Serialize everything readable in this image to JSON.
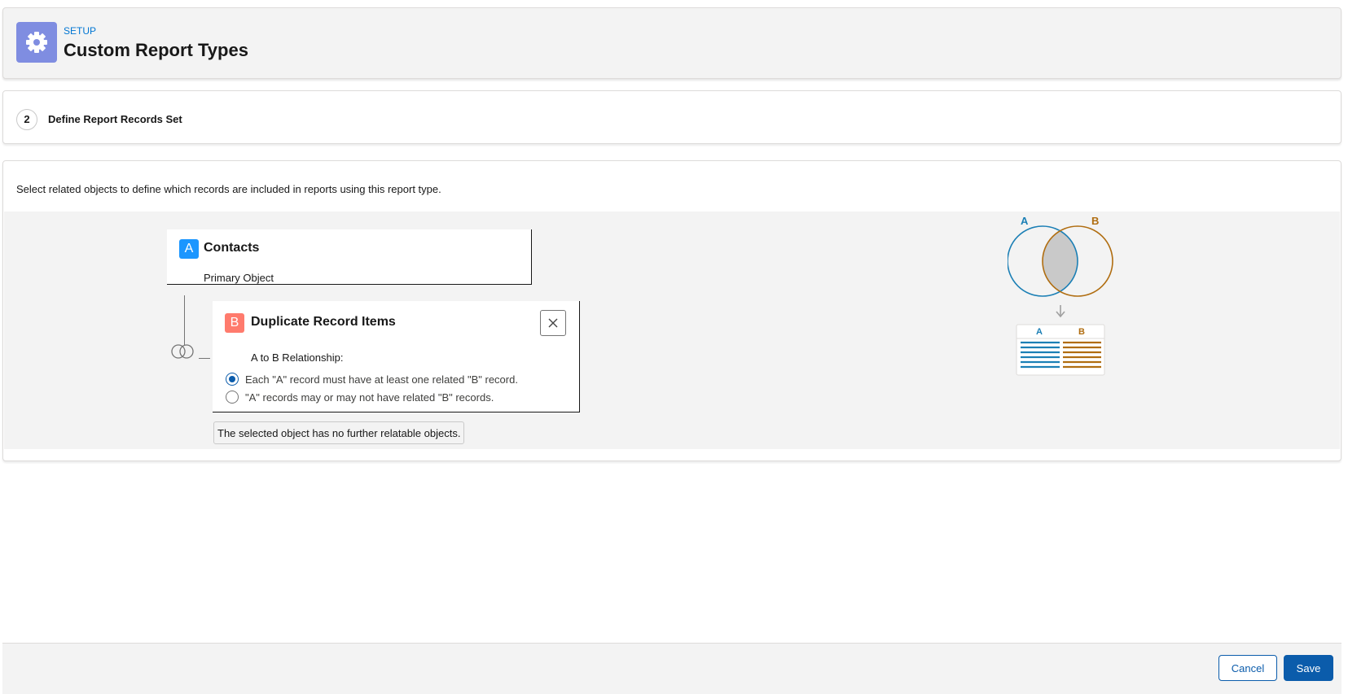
{
  "header": {
    "eyebrow": "SETUP",
    "title": "Custom Report Types",
    "icon": "gear-icon",
    "icon_bg_color": "#7f8de1"
  },
  "step": {
    "number": "2",
    "label": "Define Report Records Set"
  },
  "main": {
    "instructions": "Select related objects to define which records are included in reports using this report type.",
    "object_a": {
      "badge": "A",
      "name": "Contacts",
      "subtitle": "Primary Object",
      "badge_color": "#1b96ff"
    },
    "object_b": {
      "badge": "B",
      "name": "Duplicate Record Items",
      "badge_color": "#ff7b6d",
      "relationship_label": "A to B Relationship:",
      "options": [
        {
          "label": "Each \"A\" record must have at least one related \"B\" record.",
          "selected": true
        },
        {
          "label": "\"A\" records may or may not have related \"B\" records.",
          "selected": false
        }
      ]
    },
    "note": "The selected object has no further relatable objects.",
    "venn": {
      "label_a": "A",
      "label_b": "B",
      "table_header_a": "A",
      "table_header_b": "B",
      "color_a": "#1b7fb5",
      "color_b": "#b06d10"
    }
  },
  "footer": {
    "cancel_label": "Cancel",
    "save_label": "Save",
    "primary_color": "#0b5cab"
  }
}
